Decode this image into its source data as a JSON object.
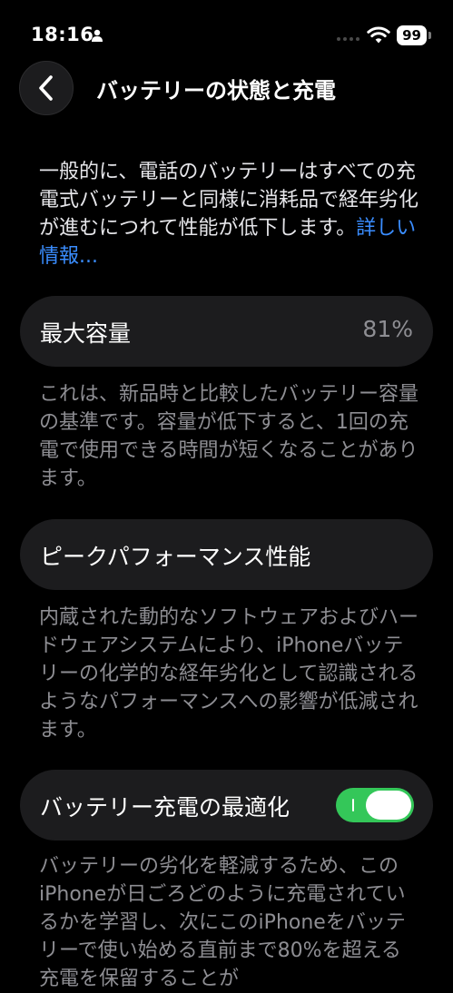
{
  "status_bar": {
    "time": "18:16",
    "battery_level": "99"
  },
  "nav": {
    "title": "バッテリーの状態と充電"
  },
  "intro": {
    "text": "一般的に、電話のバッテリーはすべての充電式バッテリーと同様に消耗品で経年劣化が進むにつれて性能が低下します。",
    "link": "詳しい情報..."
  },
  "max_capacity": {
    "label": "最大容量",
    "value": "81%",
    "description": "これは、新品時と比較したバッテリー容量の基準です。容量が低下すると、1回の充電で使用できる時間が短くなることがあります。"
  },
  "peak_performance": {
    "label": "ピークパフォーマンス性能",
    "description": "内蔵された動的なソフトウェアおよびハードウェアシステムにより、iPhoneバッテリーの化学的な経年劣化として認識されるようなパフォーマンスへの影響が低減されます。"
  },
  "optimized_charging": {
    "label": "バッテリー充電の最適化",
    "enabled": true,
    "description": "バッテリーの劣化を軽減するため、このiPhoneが日ごろどのように充電されているかを学習し、次にこのiPhoneをバッテリーで使い始める直前まで80%を超える充電を保留することが"
  },
  "colors": {
    "background": "#000000",
    "card": "#1c1c1e",
    "link": "#3a8dff",
    "toggle_on": "#34c759",
    "secondary_text": "#8e8e93"
  }
}
